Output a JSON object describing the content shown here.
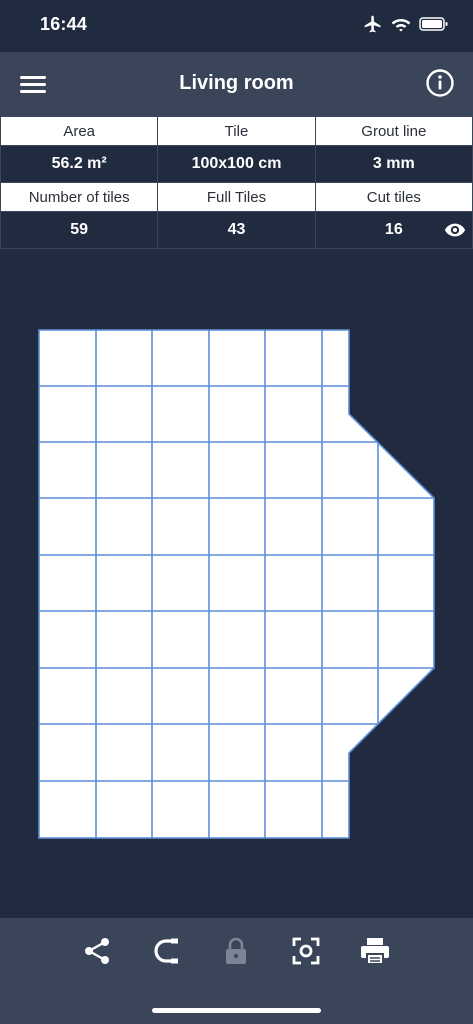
{
  "status_bar": {
    "time": "16:44"
  },
  "header": {
    "title": "Living room"
  },
  "info": {
    "area_label": "Area",
    "area_value": "56.2 m²",
    "tile_label": "Tile",
    "tile_value": "100x100 cm",
    "grout_label": "Grout line",
    "grout_value": "3 mm",
    "tiles_label": "Number of tiles",
    "tiles_value": "59",
    "full_label": "Full Tiles",
    "full_value": "43",
    "cut_label": "Cut tiles",
    "cut_value": "16"
  },
  "toolbar": {
    "icons": [
      "share-icon",
      "magnet-icon",
      "lock-icon",
      "focus-icon",
      "print-icon"
    ],
    "lock_enabled": false
  },
  "colors": {
    "background": "#212b3f",
    "bar": "#3a4559",
    "tile_grid": "#5a8ed8"
  }
}
